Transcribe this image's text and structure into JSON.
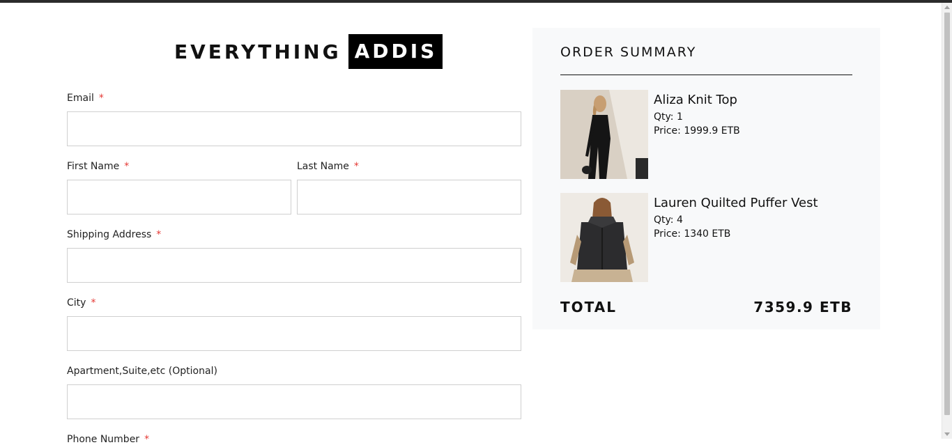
{
  "brand": {
    "part1": "EVERYTHING",
    "part2": "ADDIS"
  },
  "form": {
    "required_mark": "*",
    "email_label": "Email",
    "email_value": "",
    "first_name_label": "First Name",
    "first_name_value": "",
    "last_name_label": "Last Name",
    "last_name_value": "",
    "shipping_address_label": "Shipping Address",
    "shipping_address_value": "",
    "city_label": "City",
    "city_value": "",
    "apartment_label": "Apartment,Suite,etc (Optional)",
    "apartment_value": "",
    "phone_label": "Phone Number"
  },
  "summary": {
    "title": "ORDER SUMMARY",
    "items": [
      {
        "name": "Aliza Knit Top",
        "qty": "Qty: 1",
        "price": "Price: 1999.9 ETB"
      },
      {
        "name": "Lauren Quilted Puffer Vest",
        "qty": "Qty: 4",
        "price": "Price: 1340 ETB"
      }
    ],
    "total_label": "TOTAL",
    "total_value": "7359.9 ETB"
  },
  "colors": {
    "required": "#e53935",
    "summary_bg": "#f8f9fa",
    "brand_block": "#000000"
  }
}
